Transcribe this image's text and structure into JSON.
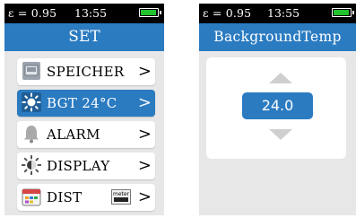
{
  "left_screen": {
    "status": {
      "emissivity": "ε = 0.95",
      "time": "13:55",
      "battery_level": 1.0
    },
    "title": "SET",
    "menu": [
      {
        "label": "SPEICHER",
        "chevron": ">",
        "icon": "memory-card-icon",
        "selected": false
      },
      {
        "label": "BGT  24°C",
        "chevron": ">",
        "icon": "sun-icon",
        "selected": true
      },
      {
        "label": "ALARM",
        "chevron": ">",
        "icon": "bell-icon",
        "selected": false
      },
      {
        "label": "DISPLAY",
        "chevron": ">",
        "icon": "brightness-icon",
        "selected": false
      },
      {
        "label": "DIST",
        "chevron": ">",
        "icon": "calendar-icon",
        "selected": false,
        "badge": "meter"
      }
    ]
  },
  "right_screen": {
    "status": {
      "emissivity": "ε = 0.95",
      "time": "13:55",
      "battery_level": 1.0
    },
    "title": "BackgroundTemp",
    "value": "24.0",
    "icons": {
      "up": "arrow-up-icon",
      "down": "arrow-down-icon"
    }
  },
  "colors": {
    "accent": "#2b7bc1",
    "battery": "#21c32e",
    "background": "#e7e7e7",
    "status_bar": "#000000"
  }
}
